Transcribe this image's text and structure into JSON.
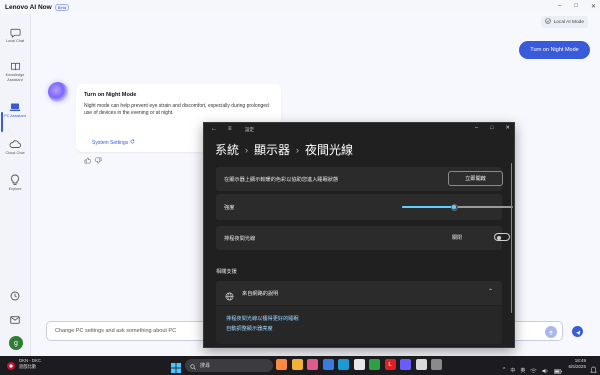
{
  "app": {
    "title": "Lenovo AI Now",
    "badge": "Beta",
    "window_controls": [
      "–",
      "□",
      "✕"
    ]
  },
  "nav": {
    "items": [
      {
        "label": "Local Chat",
        "icon": "chat-icon"
      },
      {
        "label": "Knowledge Assistant",
        "icon": "book-icon"
      },
      {
        "label": "PC Assistant",
        "icon": "laptop-icon",
        "active": true
      },
      {
        "label": "Cloud Chat",
        "icon": "cloud-icon"
      },
      {
        "label": "Explore",
        "icon": "lightbulb-icon"
      }
    ],
    "bottom": [
      "history-icon",
      "mail-icon"
    ],
    "user_initial": "g"
  },
  "main": {
    "local_ai_mode": "Local AI Mode",
    "user_message": "Turn on Night Mode",
    "ai_response": {
      "title": "Turn on Night Mode",
      "body": "Night mode can help prevent eye strain and discomfort, especially during prolonged use of devices in the evening or at night.",
      "link": "System Settings"
    },
    "input_placeholder": "Change PC settings and ask something about PC"
  },
  "settings": {
    "app_title": "設定",
    "breadcrumb": [
      "系統",
      "顯示器",
      "夜間光線"
    ],
    "rows": {
      "apply_label": "在顯示器上顯示較暖的色彩以協助您進入睡眠狀態",
      "apply_button": "立即開啟",
      "strength_label": "強度",
      "strength_value": 0.47,
      "schedule_label": "排程夜間光線",
      "schedule_state": "關閉"
    },
    "related_title": "相關支援",
    "help_header": "來自網路的說明",
    "help_links": [
      "排程夜間光線以獲得更好的睡眠",
      "自動調整顯示器亮度"
    ],
    "accent": "#60cdff"
  },
  "taskbar": {
    "weather_temp": "DKN - DKC",
    "weather_desc": "遊戲比數",
    "search": "搜尋",
    "pinned": [
      {
        "name": "widgets-icon",
        "color": "#ff8a3d",
        "glyph": ""
      },
      {
        "name": "file-explorer-icon",
        "color": "#f2b233",
        "glyph": ""
      },
      {
        "name": "photos-icon",
        "color": "#e05a8c",
        "glyph": ""
      },
      {
        "name": "store-icon",
        "color": "#3a7be0",
        "glyph": ""
      },
      {
        "name": "edge-icon",
        "color": "#1c9ad6",
        "glyph": ""
      },
      {
        "name": "chrome-icon",
        "color": "#e8e8e8",
        "glyph": ""
      },
      {
        "name": "xbox-icon",
        "color": "#2ea043",
        "glyph": ""
      },
      {
        "name": "lenovo-app-icon",
        "color": "#e02020",
        "glyph": "L"
      },
      {
        "name": "ai-now-icon",
        "color": "#6a5cff",
        "glyph": ""
      },
      {
        "name": "app-icon",
        "color": "#d8d8d8",
        "glyph": ""
      },
      {
        "name": "settings-icon",
        "color": "#8a8a8a",
        "glyph": ""
      }
    ],
    "tray": [
      "^",
      "中",
      "英"
    ],
    "time": "18:49",
    "date": "6/5/2025"
  }
}
